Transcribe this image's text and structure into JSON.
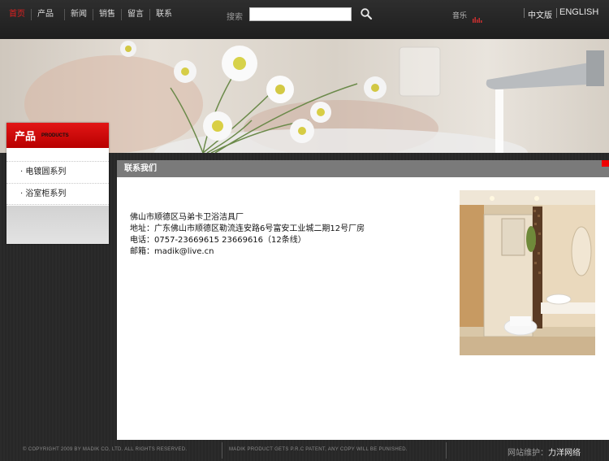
{
  "nav": {
    "items": [
      "首页",
      "产品",
      "新闻",
      "销售",
      "留言",
      "联系"
    ],
    "active_index": 0
  },
  "search": {
    "label": "搜索",
    "value": "",
    "placeholder": ""
  },
  "music": {
    "label": "音乐"
  },
  "lang": {
    "chinese": "中文版",
    "english": "ENGLISH"
  },
  "sidebar": {
    "title": "产品",
    "subtitle": "PRODUCTS",
    "items": [
      {
        "label": "· 电镀圆系列"
      },
      {
        "label": "· 浴室柜系列"
      }
    ]
  },
  "main": {
    "heading": "联系我们",
    "contact": {
      "company": "佛山市顺德区马弟卡卫浴洁具厂",
      "address": "地址：广东佛山市顺德区勒流连安路6号富安工业城二期12号厂房",
      "phone": "电话：0757-23669615  23669616（12条线）",
      "email": "邮箱：madik@live.cn"
    }
  },
  "footer": {
    "copyright": "© COPYRIGHT 2009 BY MADIK CO, LTD. ALL RIGHTS RESERVED.",
    "patent": "MADIK PRODUCT GETS P.R.C PATENT, ANY COPY WILL BE PUNISHED.",
    "maintain_label": "网站维护：",
    "maintain_value": "力洋网络"
  },
  "colors": {
    "accent_red": "#e02020",
    "header_gray": "#7a7a7a",
    "background_dark": "#2a2a2a"
  }
}
